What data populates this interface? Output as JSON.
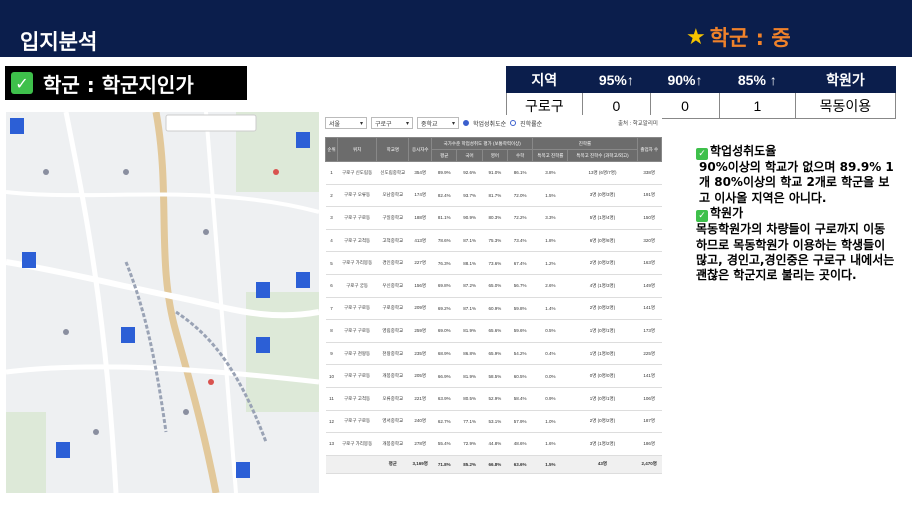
{
  "header": {
    "title": "입지분석",
    "right_title": "학군 : 중"
  },
  "section": {
    "label": "학군 : 학군지인가"
  },
  "summary_table": {
    "headers": [
      "지역",
      "95%↑",
      "90%↑",
      "85% ↑",
      "학원가"
    ],
    "row": [
      "구로구",
      "0",
      "0",
      "1",
      "목동이용"
    ]
  },
  "school_table": {
    "filters": {
      "region1": "서울",
      "region2": "구로구",
      "level": "중학교",
      "opt1": "학업성취도순",
      "opt2": "진학률순",
      "source": "출처 : 학교알리미"
    },
    "header_groups": {
      "achievement": "국가수준 학업성취도 평가 (보통학력이상)",
      "advance": "진학률"
    },
    "headers": [
      "순위",
      "위치",
      "학교명",
      "응시자수",
      "평균",
      "국어",
      "영어",
      "수학",
      "특목고 진학률",
      "특목고 진학수 (과학고/외고)",
      "졸업자 수"
    ],
    "rows": [
      [
        "1",
        "구로구 신도림동",
        "신도림중학교",
        "354명",
        "89.9%",
        "92.6%",
        "91.0%",
        "86.1%",
        "3.8%",
        "13명 (6명/7명)",
        "338명"
      ],
      [
        "2",
        "구로구 오류동",
        "오남중학교",
        "174명",
        "82.4%",
        "93.7%",
        "81.7%",
        "72.0%",
        "1.5%",
        "3명 (0명/3명)",
        "191명"
      ],
      [
        "3",
        "구로구 구로동",
        "구일중학교",
        "188명",
        "81.1%",
        "90.9%",
        "80.3%",
        "72.2%",
        "3.3%",
        "5명 (1명/4명)",
        "150명"
      ],
      [
        "4",
        "구로구 고척동",
        "고척중학교",
        "413명",
        "78.6%",
        "87.1%",
        "75.3%",
        "73.4%",
        "1.8%",
        "6명 (0명/6명)",
        "320명"
      ],
      [
        "5",
        "구로구 가리봉동",
        "경인중학교",
        "227명",
        "76.3%",
        "88.1%",
        "73.6%",
        "67.4%",
        "1.2%",
        "2명 (0명/2명)",
        "163명"
      ],
      [
        "6",
        "구로구 궁동",
        "우신중학교",
        "156명",
        "69.8%",
        "87.2%",
        "65.0%",
        "56.7%",
        "2.6%",
        "4명 (1명/3명)",
        "149명"
      ],
      [
        "7",
        "구로구 구로동",
        "구로중학교",
        "209명",
        "69.2%",
        "87.1%",
        "60.9%",
        "59.8%",
        "1.4%",
        "2명 (0명/2명)",
        "141명"
      ],
      [
        "8",
        "구로구 구로동",
        "영림중학교",
        "259명",
        "69.0%",
        "81.9%",
        "65.6%",
        "59.6%",
        "0.5%",
        "1명 (0명/1명)",
        "173명"
      ],
      [
        "9",
        "구로구 천왕동",
        "천왕중학교",
        "235명",
        "68.9%",
        "86.8%",
        "65.9%",
        "54.2%",
        "0.4%",
        "1명 (1명/0명)",
        "225명"
      ],
      [
        "10",
        "구로구 구로동",
        "개봉중학교",
        "205명",
        "66.9%",
        "81.9%",
        "58.5%",
        "60.5%",
        "0.0%",
        "0명 (0명/0명)",
        "141명"
      ],
      [
        "11",
        "구로구 고척동",
        "오류중학교",
        "221명",
        "63.9%",
        "80.5%",
        "52.9%",
        "58.4%",
        "0.9%",
        "1명 (0명/1명)",
        "106명"
      ],
      [
        "12",
        "구로구 구로동",
        "영서중학교",
        "240명",
        "62.7%",
        "77.1%",
        "53.1%",
        "57.9%",
        "1.0%",
        "2명 (0명/2명)",
        "187명"
      ],
      [
        "13",
        "구로구 가리봉동",
        "개봉중학교",
        "278명",
        "55.4%",
        "72.9%",
        "44.8%",
        "48.6%",
        "1.6%",
        "3명 (1명/2명)",
        "186명"
      ]
    ],
    "average": [
      "",
      "",
      "평균",
      "3,169명",
      "71.8%",
      "85.2%",
      "66.8%",
      "63.6%",
      "1.5%",
      "43명",
      "2,470명"
    ]
  },
  "notes": {
    "h1": "학업성취도율",
    "p1": "90%이상의 학교가 없으며 89.9% 1개 80%이상의 학교 2개로 학군을 보고 이사올 지역은 아니다.",
    "h2": "학원가",
    "p2": "목동학원가의 차량들이 구로까지 이동하므로 목동학원가 이용하는 학생들이 많고, 경인고,경인중은 구로구 내에서는 괜찮은 학군지로 불리는 곳이다."
  },
  "colors": {
    "navy": "#0b1e4c",
    "orange": "#f0822a",
    "green": "#3ec04b"
  }
}
